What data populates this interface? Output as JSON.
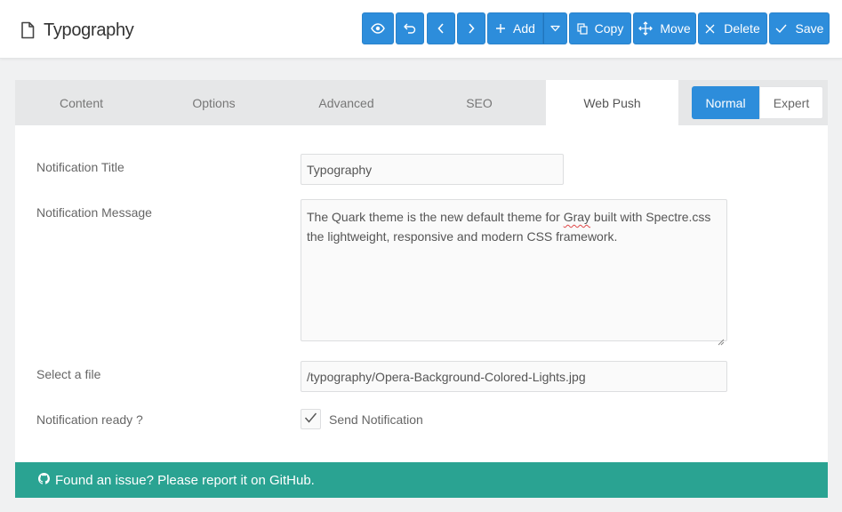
{
  "header": {
    "title": "Typography",
    "icons": {
      "page": "document-icon"
    }
  },
  "toolbar": {
    "preview_icon": "eye-icon",
    "revert_icon": "undo-icon",
    "prev_icon": "chevron-left-icon",
    "next_icon": "chevron-right-icon",
    "add_label": "Add",
    "add_more_icon": "caret-down-icon",
    "copy_label": "Copy",
    "move_label": "Move",
    "delete_label": "Delete",
    "save_label": "Save",
    "accent": "#2d8ddb"
  },
  "tabs": [
    {
      "label": "Content"
    },
    {
      "label": "Options"
    },
    {
      "label": "Advanced"
    },
    {
      "label": "SEO"
    },
    {
      "label": "Web Push",
      "active": true
    }
  ],
  "mode": {
    "normal": "Normal",
    "expert": "Expert",
    "selected": "Normal"
  },
  "form": {
    "title_label": "Notification Title",
    "title_value": "Typography",
    "message_label": "Notification Message",
    "message_before": "The Quark theme is the new default theme for ",
    "message_flagged": "Gray",
    "message_after": " built with Spectre.css the lightweight, responsive and modern CSS framework.",
    "file_label": "Select a file",
    "file_value": "/typography/Opera-Background-Colored-Lights.jpg",
    "ready_label": "Notification ready ?",
    "ready_checkbox_label": "Send Notification",
    "ready_checked": true
  },
  "footer": {
    "text": "Found an issue? Please report it on GitHub.",
    "icon": "github-icon",
    "color": "#2aa392"
  }
}
